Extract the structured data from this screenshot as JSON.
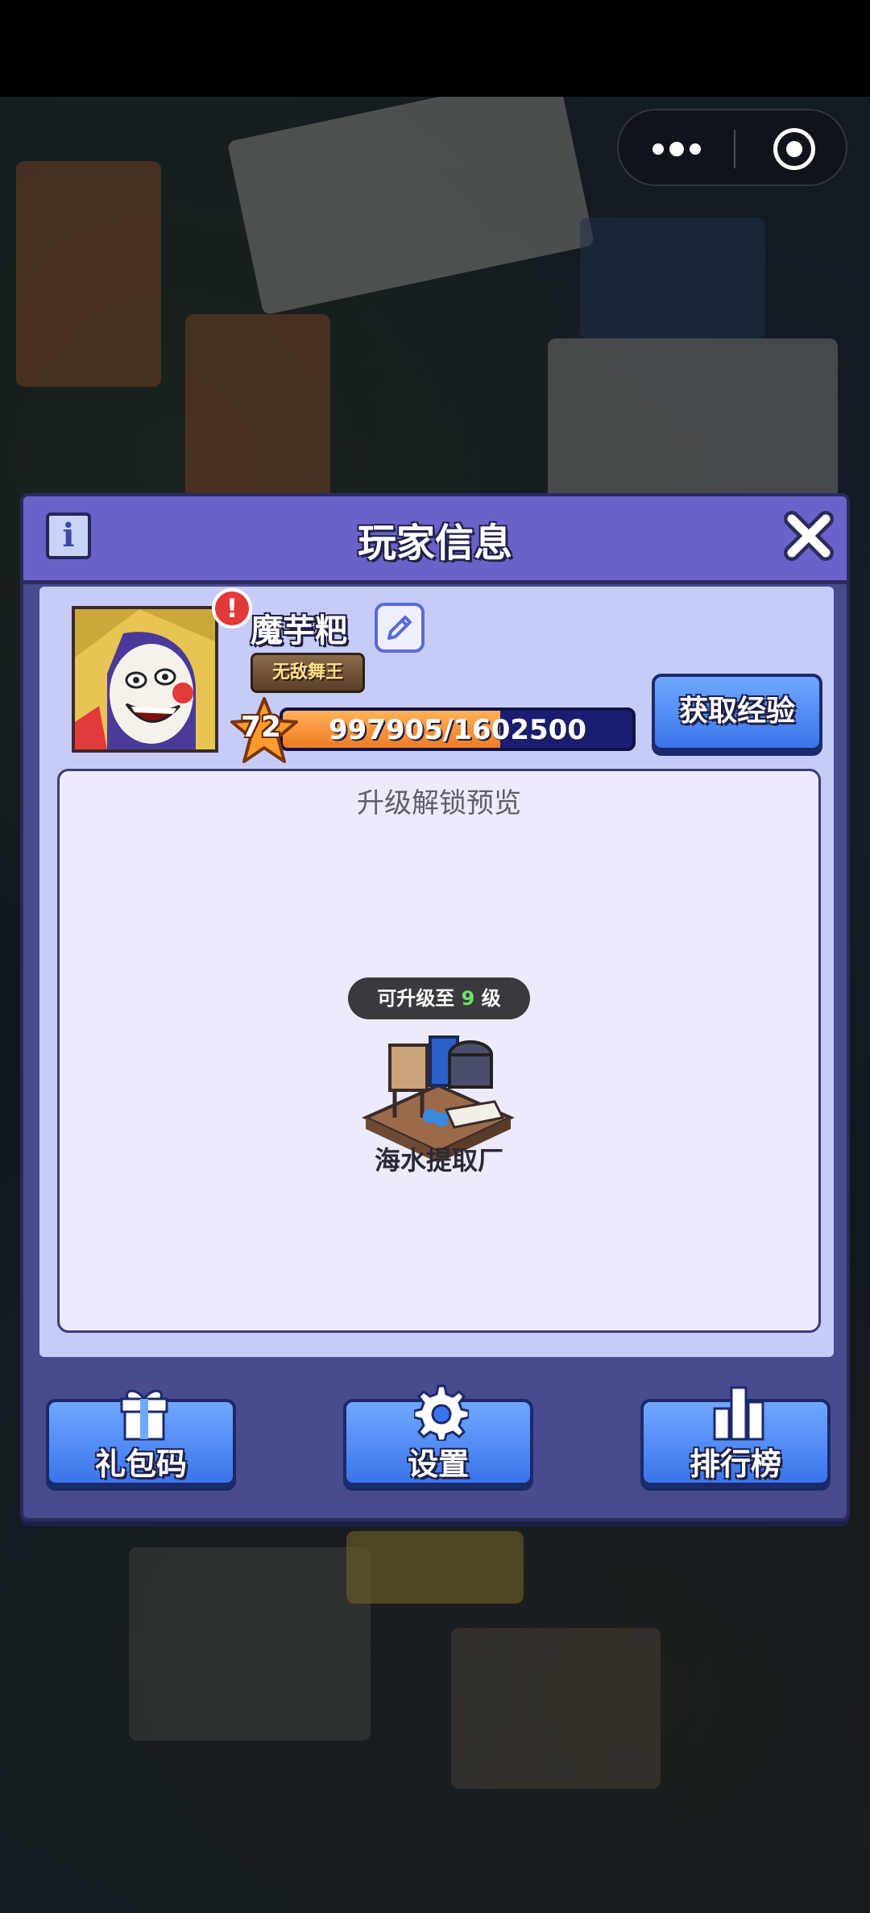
{
  "dialog": {
    "title": "玩家信息"
  },
  "player": {
    "name": "魔芋粑",
    "title_badge": "无敌舞王",
    "level": "72",
    "exp_text": "997905/1602500",
    "exp_progress": 0.623
  },
  "actions": {
    "get_exp": "获取经验"
  },
  "preview": {
    "title": "升级解锁预览",
    "unlock_prefix": "可升级至",
    "unlock_level": "9",
    "unlock_suffix": "级",
    "building_name": "海水提取厂"
  },
  "bottom_buttons": {
    "gift_code": "礼包码",
    "settings": "设置",
    "leaderboard": "排行榜"
  },
  "colors": {
    "header": "#6a62c8",
    "panel": "#c7ccf7",
    "button": "#3a74ea",
    "exp_fill": "#f07a24",
    "exp_track": "#1a1d72"
  }
}
